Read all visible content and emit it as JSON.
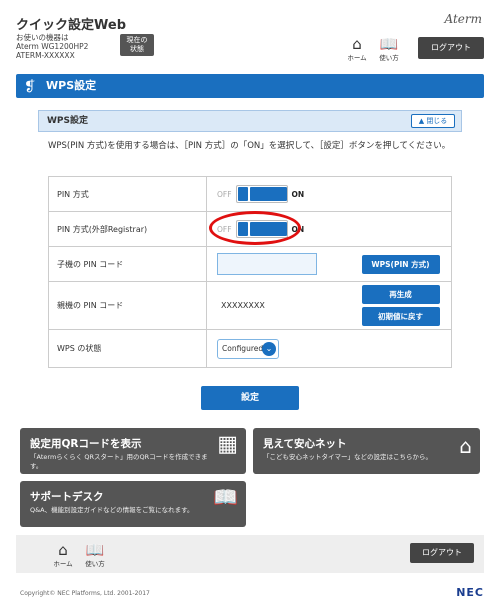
{
  "header": {
    "title": "クイック設定Web",
    "device_label": "お使いの機器は",
    "model": "Aterm WG1200HP2",
    "ssid": "ATERM-XXXXXX",
    "status_btn_line1": "現在の",
    "status_btn_line2": "状態",
    "brand": "Aterm",
    "home_label": "ホーム",
    "manual_label": "使い方",
    "logout": "ログアウト"
  },
  "section": {
    "title": "WPS設定"
  },
  "panel": {
    "title": "WPS設定",
    "close_label": "閉じる",
    "description": "WPS(PIN 方式)を使用する場合は、［PIN 方式］の「ON」を選択して、［設定］ボタンを押してください。",
    "rows": {
      "pin_method": {
        "label": "PIN 方式",
        "off": "OFF",
        "on": "ON"
      },
      "pin_registrar": {
        "label": "PIN 方式(外部Registrar)",
        "off": "OFF",
        "on": "ON"
      },
      "client_pin": {
        "label": "子機の PIN コード",
        "input_value": "",
        "button": "WPS(PIN 方式)"
      },
      "parent_pin": {
        "label": "親機の PIN コード",
        "value": "XXXXXXXX",
        "regen": "再生成",
        "reset": "初期値に戻す"
      },
      "wps_status": {
        "label": "WPS の状態",
        "selected": "Configured"
      }
    },
    "apply": "設定"
  },
  "tiles": {
    "qr": {
      "title": "設定用QRコードを表示",
      "desc_line1": "「Atermらくらく QRスタート」用のQRコードを作成できま",
      "desc_line2": "す。"
    },
    "safety": {
      "title": "見えて安心ネット",
      "desc": "「こども安心ネットタイマー」などの設定はこちらから。"
    },
    "support": {
      "title": "サポートデスク",
      "desc": "Q&A、機能別設定ガイドなどの情報をご覧になれます。"
    }
  },
  "footer": {
    "home_label": "ホーム",
    "manual_label": "使い方",
    "logout": "ログアウト",
    "copyright": "Copyright© NEC Platforms, Ltd. 2001-2017",
    "logo": "NEC"
  }
}
